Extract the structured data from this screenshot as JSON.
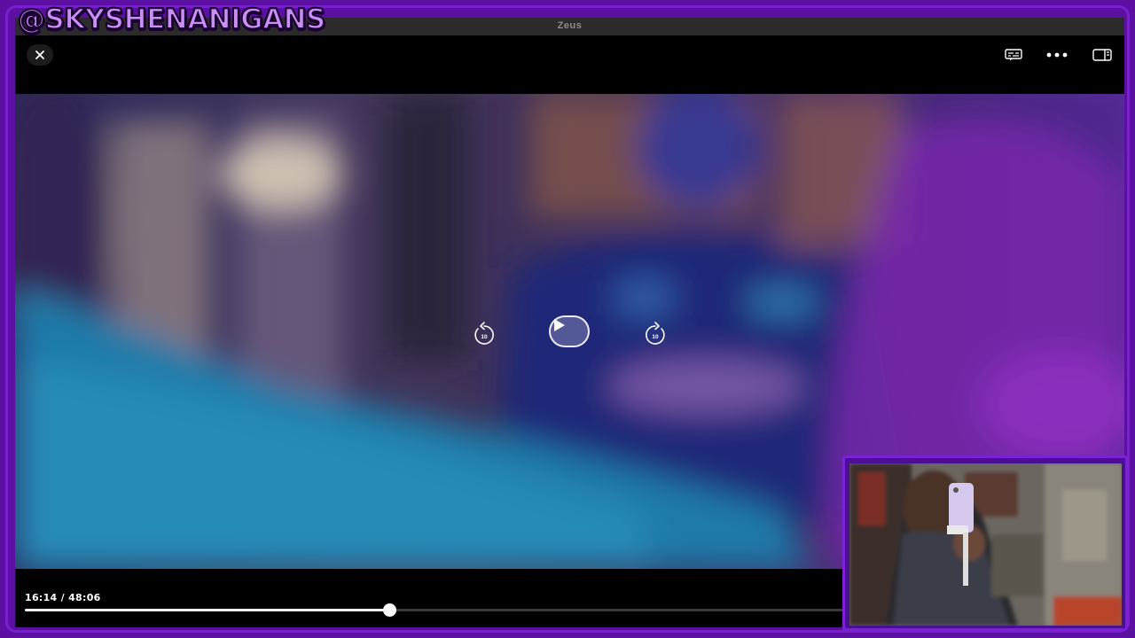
{
  "watermark": {
    "text": "@SKYSHENANIGANS"
  },
  "window": {
    "title": "Zeus"
  },
  "top_controls": {
    "close_icon": "close-icon",
    "captions_icon": "captions-icon",
    "more_icon": "more-options-icon",
    "sidebar_icon": "sidebar-icon"
  },
  "center_controls": {
    "skip_back_seconds": "10",
    "skip_forward_seconds": "10",
    "play_icon": "play-icon"
  },
  "playback": {
    "time_readout": "16:14 / 48:06",
    "progress_fraction": 0.3375
  },
  "colors": {
    "frame": "#5b10a3",
    "accent": "#7a1fd0",
    "watermark": "#c98ff5"
  }
}
